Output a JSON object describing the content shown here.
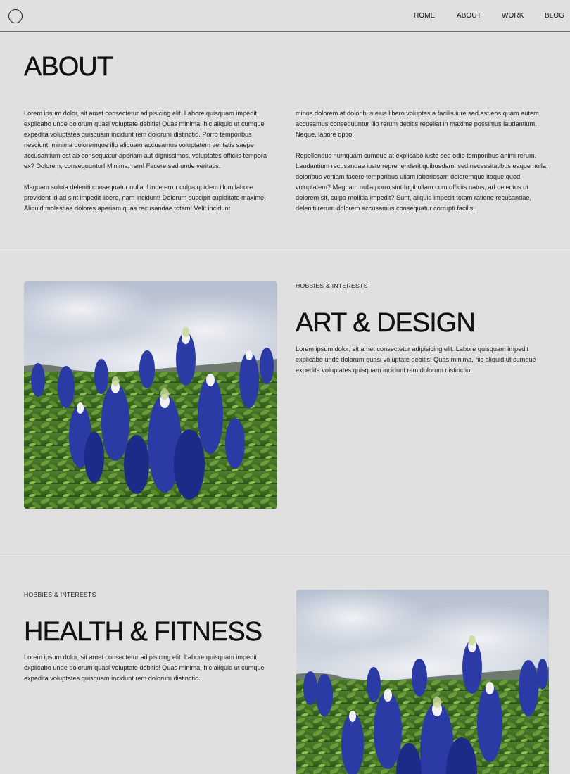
{
  "nav": {
    "links": [
      "HOME",
      "ABOUT",
      "WORK",
      "BLOG"
    ]
  },
  "about": {
    "title": "ABOUT",
    "left_paragraphs": [
      "Lorem ipsum dolor, sit amet consectetur adipisicing elit. Labore quisquam impedit explicabo unde dolorum quasi voluptate debitis! Quas minima, hic aliquid ut cumque expedita voluptates quisquam incidunt rem dolorum distinctio. Porro temporibus nesciunt, minima doloremque illo aliquam accusamus voluptatem veritatis saepe accusantium est ab consequatur aperiam aut dignissimos, voluptates officiis tempora ex? Dolorem, consequuntur! Minima, rem! Facere sed unde veritatis.",
      "Magnam soluta deleniti consequatur nulla. Unde error culpa quidem illum labore provident id ad sint impedit libero, nam incidunt! Dolorum suscipit cupiditate maxime. Aliquid molestiae dolores aperiam quas recusandae totam! Velit incidunt"
    ],
    "right_paragraphs": [
      "minus dolorem at doloribus eius libero voluptas a facilis iure sed est eos quam autem, accusamus consequuntur illo rerum debitis repellat in maxime possimus laudantium. Neque, labore optio.",
      "Repellendus numquam cumque at explicabo iusto sed odio temporibus animi rerum. Laudantium recusandae iusto reprehenderit quibusdam, sed necessitatibus eaque nulla, doloribus veniam facere temporibus ullam laboriosam doloremque itaque quod voluptatem? Magnam nulla porro sint fugit ullam cum officiis natus, ad delectus ut dolorem sit, culpa mollitia impedit? Sunt, aliquid impedit totam ratione recusandae, deleniti rerum dolorem accusamus consequatur corrupti facilis!"
    ]
  },
  "art": {
    "eyebrow": "HOBBIES & INTERESTS",
    "title": "ART & DESIGN",
    "body": "Lorem ipsum dolor, sit amet consectetur adipisicing elit. Labore quisquam impedit explicabo unde dolorum quasi voluptate debitis! Quas minima, hic aliquid ut cumque expedita voluptates quisquam incidunt rem dolorum distinctio."
  },
  "health": {
    "eyebrow": "HOBBIES & INTERESTS",
    "title": "HEALTH & FITNESS",
    "body": "Lorem ipsum dolor, sit amet consectetur adipisicing elit. Labore quisquam impedit explicabo unde dolorum quasi voluptate debitis! Quas minima, hic aliquid ut cumque expedita voluptates quisquam incidunt rem dolorum distinctio."
  },
  "colors": {
    "background": "#e0e0e0",
    "text": "#111111",
    "divider": "#6a6a6a"
  },
  "icons": {
    "logo": "circle-logo-icon"
  }
}
